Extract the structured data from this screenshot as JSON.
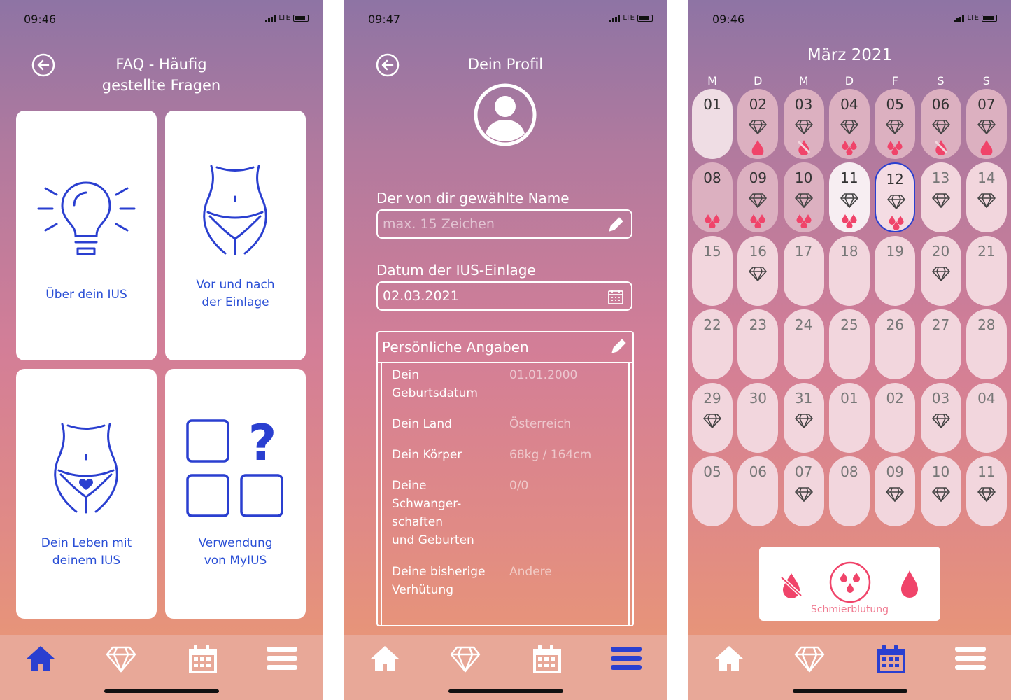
{
  "status": {
    "time_1": "09:46",
    "time_2": "09:47",
    "time_3": "09:46",
    "network": "LTE"
  },
  "faq": {
    "title_line1": "FAQ - Häufig",
    "title_line2": "gestellte Fragen",
    "cards": [
      {
        "line1": "Über dein IUS",
        "line2": "",
        "icon": "lightbulb-icon"
      },
      {
        "line1": "Vor und nach",
        "line2": "der Einlage",
        "icon": "body-icon"
      },
      {
        "line1": "Dein Leben mit",
        "line2": "deinem IUS",
        "icon": "body-heart-icon"
      },
      {
        "line1": "Verwendung",
        "line2": "von MyIUS",
        "icon": "squares-question-icon"
      }
    ]
  },
  "profile": {
    "title": "Dein Profil",
    "name_label": "Der von dir gewählte Name",
    "name_placeholder": "max. 15 Zeichen",
    "date_label": "Datum der IUS-Einlage",
    "date_value": "02.03.2021",
    "personal_title": "Persönliche Angaben",
    "rows": [
      {
        "key": "Dein\nGeburtsdatum",
        "value": "01.01.2000"
      },
      {
        "key": "Dein Land",
        "value": "Österreich"
      },
      {
        "key": "Dein Körper",
        "value": "68kg / 164cm"
      },
      {
        "key": "Deine\nSchwanger-\nschaften\nund Geburten",
        "value": "0/0"
      },
      {
        "key": "Deine bisherige\nVerhütung",
        "value": "Andere"
      }
    ]
  },
  "calendar": {
    "month": "März 2021",
    "weekdays": [
      "M",
      "D",
      "M",
      "D",
      "F",
      "S",
      "S"
    ],
    "days": [
      {
        "n": "01",
        "style": "first",
        "diamond": false,
        "drops": ""
      },
      {
        "n": "02",
        "style": "f",
        "diamond": true,
        "drops": "one"
      },
      {
        "n": "03",
        "style": "f",
        "diamond": true,
        "drops": "none-strike"
      },
      {
        "n": "04",
        "style": "f",
        "diamond": true,
        "drops": "few"
      },
      {
        "n": "05",
        "style": "f",
        "diamond": true,
        "drops": "few"
      },
      {
        "n": "06",
        "style": "f",
        "diamond": true,
        "drops": "none-strike"
      },
      {
        "n": "07",
        "style": "f",
        "diamond": true,
        "drops": "one"
      },
      {
        "n": "08",
        "style": "f",
        "diamond": false,
        "drops": "few"
      },
      {
        "n": "09",
        "style": "f",
        "diamond": true,
        "drops": "few"
      },
      {
        "n": "10",
        "style": "f",
        "diamond": true,
        "drops": "few"
      },
      {
        "n": "11",
        "style": "w",
        "diamond": true,
        "drops": "few"
      },
      {
        "n": "12",
        "style": "sel",
        "diamond": true,
        "drops": "few"
      },
      {
        "n": "13",
        "style": "",
        "diamond": true,
        "drops": "",
        "grey": true
      },
      {
        "n": "14",
        "style": "",
        "diamond": true,
        "drops": "",
        "grey": true
      },
      {
        "n": "15",
        "style": "",
        "diamond": false,
        "drops": "",
        "grey": true
      },
      {
        "n": "16",
        "style": "",
        "diamond": true,
        "drops": "",
        "grey": true
      },
      {
        "n": "17",
        "style": "",
        "diamond": false,
        "drops": "",
        "grey": true
      },
      {
        "n": "18",
        "style": "",
        "diamond": false,
        "drops": "",
        "grey": true
      },
      {
        "n": "19",
        "style": "",
        "diamond": false,
        "drops": "",
        "grey": true
      },
      {
        "n": "20",
        "style": "",
        "diamond": true,
        "drops": "",
        "grey": true
      },
      {
        "n": "21",
        "style": "",
        "diamond": false,
        "drops": "",
        "grey": true
      },
      {
        "n": "22",
        "style": "",
        "diamond": false,
        "drops": "",
        "grey": true
      },
      {
        "n": "23",
        "style": "",
        "diamond": false,
        "drops": "",
        "grey": true
      },
      {
        "n": "24",
        "style": "",
        "diamond": false,
        "drops": "",
        "grey": true
      },
      {
        "n": "25",
        "style": "",
        "diamond": false,
        "drops": "",
        "grey": true
      },
      {
        "n": "26",
        "style": "",
        "diamond": false,
        "drops": "",
        "grey": true
      },
      {
        "n": "27",
        "style": "",
        "diamond": false,
        "drops": "",
        "grey": true
      },
      {
        "n": "28",
        "style": "",
        "diamond": false,
        "drops": "",
        "grey": true
      },
      {
        "n": "29",
        "style": "",
        "diamond": true,
        "drops": "",
        "grey": true
      },
      {
        "n": "30",
        "style": "",
        "diamond": false,
        "drops": "",
        "grey": true
      },
      {
        "n": "31",
        "style": "",
        "diamond": true,
        "drops": "",
        "grey": true
      },
      {
        "n": "01",
        "style": "",
        "diamond": false,
        "drops": "",
        "grey": true
      },
      {
        "n": "02",
        "style": "",
        "diamond": false,
        "drops": "",
        "grey": true
      },
      {
        "n": "03",
        "style": "",
        "diamond": true,
        "drops": "",
        "grey": true
      },
      {
        "n": "04",
        "style": "",
        "diamond": false,
        "drops": "",
        "grey": true
      },
      {
        "n": "05",
        "style": "",
        "diamond": false,
        "drops": "",
        "grey": true
      },
      {
        "n": "06",
        "style": "",
        "diamond": false,
        "drops": "",
        "grey": true
      },
      {
        "n": "07",
        "style": "",
        "diamond": true,
        "drops": "",
        "grey": true
      },
      {
        "n": "08",
        "style": "",
        "diamond": false,
        "drops": "",
        "grey": true
      },
      {
        "n": "09",
        "style": "",
        "diamond": true,
        "drops": "",
        "grey": true
      },
      {
        "n": "10",
        "style": "",
        "diamond": true,
        "drops": "",
        "grey": true
      },
      {
        "n": "11",
        "style": "",
        "diamond": true,
        "drops": "",
        "grey": true
      }
    ],
    "legend_label": "Schmierblutung"
  },
  "colors": {
    "accent_blue": "#2a4fd6",
    "drop_red": "#f0446a",
    "tab_inactive": "#ffffff"
  }
}
